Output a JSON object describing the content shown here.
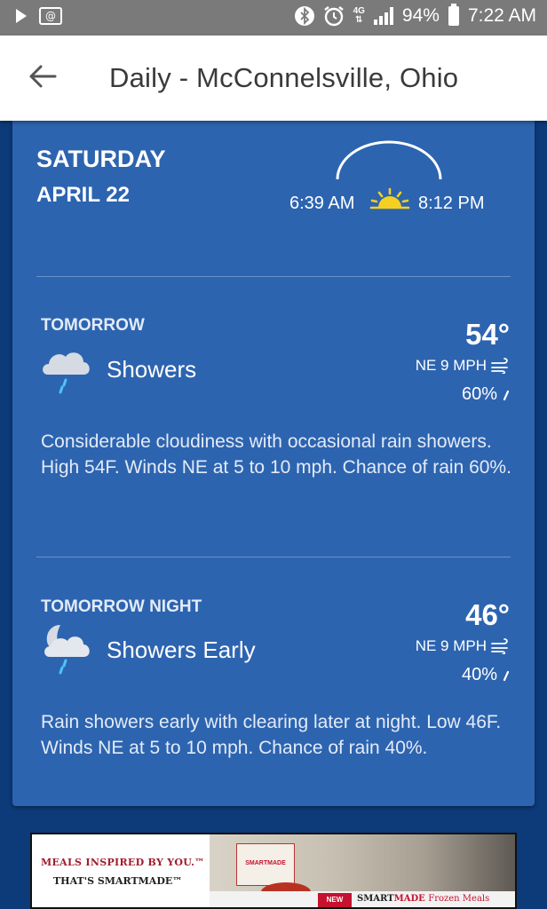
{
  "status_bar": {
    "at_symbol": "@",
    "network": "4G",
    "battery": "94%",
    "time": "7:22 AM",
    "icons": [
      "play-icon",
      "email-icon",
      "bluetooth-icon",
      "alarm-icon",
      "lte-icon",
      "signal-icon",
      "battery-icon"
    ]
  },
  "app_bar": {
    "title": "Daily - McConnelsville, Ohio",
    "back_icon": "arrow-left-icon"
  },
  "day": {
    "name": "SATURDAY",
    "date": "APRIL 22",
    "sunrise": "6:39 AM",
    "sunset": "8:12 PM"
  },
  "periods": [
    {
      "label": "TOMORROW",
      "condition": "Showers",
      "icon": "cloud-rain-icon",
      "temp": "54°",
      "wind": "NE 9 MPH",
      "precip": "60%",
      "description": "Considerable cloudiness with occasional rain showers. High 54F. Winds NE at 5 to 10 mph. Chance of rain 60%."
    },
    {
      "label": "TOMORROW NIGHT",
      "condition": "Showers Early",
      "icon": "moon-cloud-rain-icon",
      "temp": "46°",
      "wind": "NE 9 MPH",
      "precip": "40%",
      "description": "Rain showers early with clearing later at night. Low 46F. Winds NE at 5 to 10 mph. Chance of rain 40%."
    }
  ],
  "ad": {
    "line1": "MEALS INSPIRED BY YOU.™",
    "line2": "THAT'S SMARTMADE™",
    "box_label": "SMARTMADE",
    "badge": "NEW",
    "brand_a": "SMART",
    "brand_b": "MADE",
    "brand_c": "Frozen Meals"
  },
  "colors": {
    "status_bar": "#7a7a7a",
    "card": "#2d64b0",
    "background": "#0d3a78",
    "sun": "#f5d020",
    "app_bar": "#ffffff"
  }
}
